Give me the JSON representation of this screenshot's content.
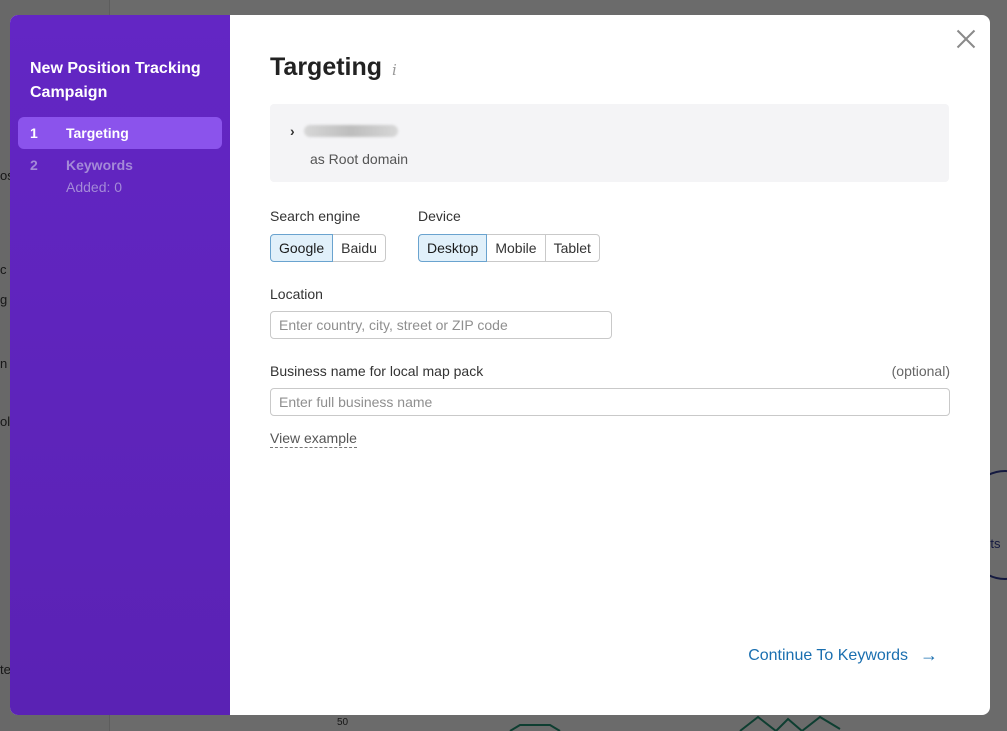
{
  "background": {
    "snippets": [
      {
        "text": "os",
        "id": "s1"
      },
      {
        "text": "c",
        "id": "s2"
      },
      {
        "text": "g",
        "id": "s3"
      },
      {
        "text": "n",
        "id": "s4"
      },
      {
        "text": "ol",
        "id": "s5"
      },
      {
        "text": "te",
        "id": "s6"
      },
      {
        "text": "rts",
        "id": "s7"
      },
      {
        "text": "50",
        "id": "s8"
      }
    ]
  },
  "modal": {
    "sidebar": {
      "title": "New Position Tracking Campaign",
      "steps": [
        {
          "number": "1",
          "label": "Targeting",
          "sub": ""
        },
        {
          "number": "2",
          "label": "Keywords",
          "sub": "Added: 0"
        }
      ]
    },
    "main": {
      "title": "Targeting",
      "info_icon": "i",
      "domain": {
        "chevron": "›",
        "subtitle": "as Root domain"
      },
      "search_engine": {
        "label": "Search engine",
        "options": [
          "Google",
          "Baidu"
        ],
        "selected": "Google"
      },
      "device": {
        "label": "Device",
        "options": [
          "Desktop",
          "Mobile",
          "Tablet"
        ],
        "selected": "Desktop"
      },
      "location": {
        "label": "Location",
        "value": "",
        "placeholder": "Enter country, city, street or ZIP code"
      },
      "business": {
        "label": "Business name for local map pack",
        "optional": "(optional)",
        "value": "",
        "placeholder": "Enter full business name"
      },
      "view_example": "View example",
      "continue_label": "Continue To Keywords",
      "continue_arrow": "→"
    }
  },
  "colors": {
    "sidebar": "#5c24b8",
    "active_step": "#8b53ec",
    "link": "#1a6fb0",
    "selected_bg": "#e1f0fa"
  }
}
